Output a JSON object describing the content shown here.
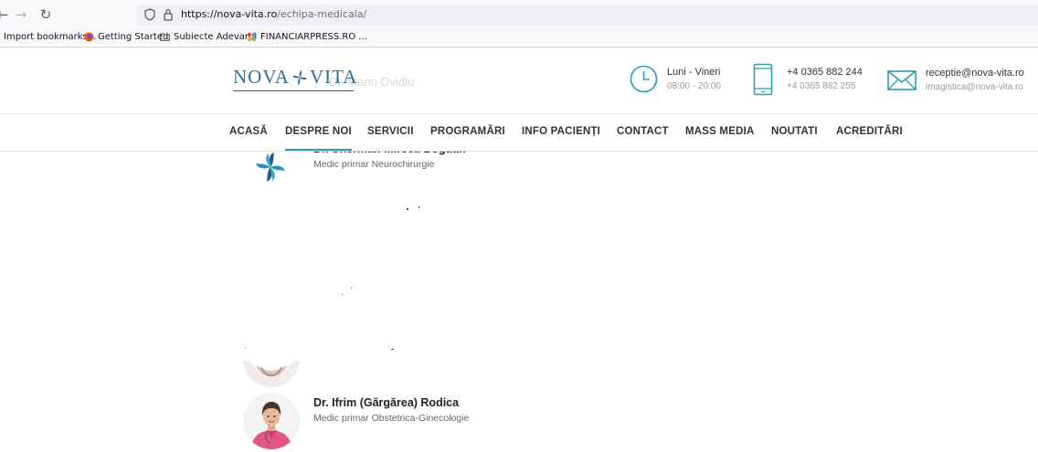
{
  "browser": {
    "url_host": "https://nova-vita.ro",
    "url_path": "/echipa-medicala/",
    "bookmarks": [
      {
        "label": "Import bookmarks...",
        "icon": "import-icon"
      },
      {
        "label": "Getting Started",
        "icon": "firefox-icon"
      },
      {
        "label": "Subiecte Adevarul",
        "icon": "folder-icon"
      },
      {
        "label": "FINANCIARPRESS.RO ...",
        "icon": "joomla-icon"
      }
    ]
  },
  "header": {
    "logo_left": "NOVA",
    "logo_right": "VITA",
    "ghost_name": "Dr. Mann Ovidiu",
    "hours": {
      "line1": "Luni - Vineri",
      "line2": "08:00 - 20:00",
      "icon": "clock-icon"
    },
    "phone": {
      "line1": "+4 0365 882 244",
      "line2": "+4 0365 882 255",
      "icon": "phone-icon"
    },
    "email": {
      "line1": "receptie@nova-vita.ro",
      "line2": "imagistica@nova-vita.ro",
      "icon": "envelope-icon"
    }
  },
  "nav": {
    "items": [
      "ACASĂ",
      "DESPRE NOI",
      "SERVICII",
      "PROGRAMĂRI",
      "INFO PACIENȚI",
      "CONTACT",
      "MASS MEDIA",
      "NOUTATI",
      "ACREDITĂRI"
    ],
    "active": "DESPRE NOI"
  },
  "doctors": [
    {
      "name": "Dr. Sherman Mircea Bogdan",
      "title": "Medic primar Neurochirurgie",
      "photo": "logo-placeholder"
    },
    {
      "name": "",
      "title": "",
      "photo": "woman-photo"
    },
    {
      "name": "Dr. Ifrim (Gărgărea) Rodica",
      "title": "Medic primar Obstetrica-Ginecologie",
      "photo": "woman-in-pink-scrubs"
    }
  ],
  "colors": {
    "brand": "#2b6f99",
    "accent": "#2a9db3",
    "scrubs": "#e05684"
  }
}
